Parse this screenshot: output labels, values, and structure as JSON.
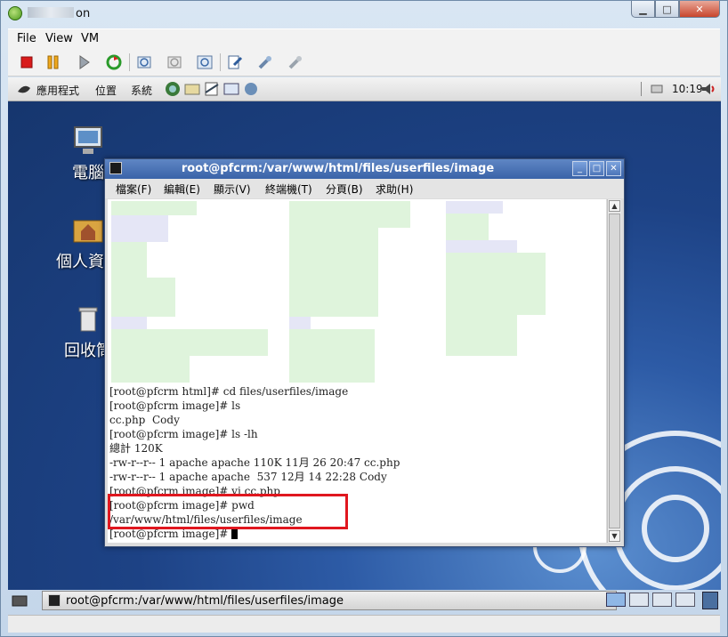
{
  "host": {
    "title_suffix": "on",
    "menu": [
      "File",
      "View",
      "VM"
    ],
    "toolbar_icons": [
      "stop-icon",
      "pause-icon",
      "play-icon",
      "refresh-icon",
      "snapshot-icon",
      "revert-snapshot-icon",
      "manage-snapshots-icon",
      "settings-icon",
      "tools-icon",
      "share-icon"
    ]
  },
  "guest_panel": {
    "menu": [
      "應用程式",
      "位置",
      "系統"
    ],
    "clock": "10:19"
  },
  "desktop_icons": [
    {
      "label": "電腦",
      "icon": "computer-icon"
    },
    {
      "label": "個人資料",
      "icon": "home-folder-icon"
    },
    {
      "label": "回收筒",
      "icon": "trash-icon"
    }
  ],
  "terminal": {
    "title": "root@pfcrm:/var/www/html/files/userfiles/image",
    "menu": [
      "檔案(F)",
      "編輯(E)",
      "顯示(V)",
      "終端機(T)",
      "分頁(B)",
      "求助(H)"
    ],
    "lines": [
      "[root@pfcrm html]# cd files/userfiles/image",
      "[root@pfcrm image]# ls",
      "cc.php  Cody",
      "[root@pfcrm image]# ls -lh",
      "總計 120K",
      "-rw-r--r-- 1 apache apache 110K 11月 26 20:47 cc.php",
      "-rw-r--r-- 1 apache apache  537 12月 14 22:28 Cody",
      "[root@pfcrm image]# vi cc.php",
      "[root@pfcrm image]# pwd",
      "/var/www/html/files/userfiles/image",
      "[root@pfcrm image]# "
    ]
  },
  "taskbar": {
    "task_label": "root@pfcrm:/var/www/html/files/userfiles/image"
  }
}
